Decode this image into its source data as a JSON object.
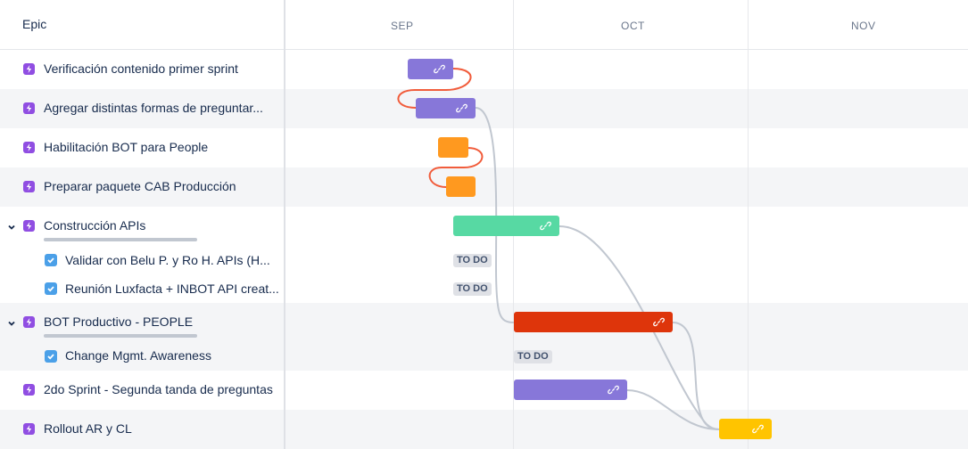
{
  "header": {
    "epic_label": "Epic",
    "months": [
      "SEP",
      "OCT",
      "NOV"
    ]
  },
  "rows": [
    {
      "label": "Verificación contenido primer sprint",
      "type": "epic"
    },
    {
      "label": "Agregar distintas formas de preguntar...",
      "type": "epic"
    },
    {
      "label": "Habilitación BOT para People",
      "type": "epic"
    },
    {
      "label": "Preparar paquete CAB Producción",
      "type": "epic"
    },
    {
      "label": "Construcción APIs",
      "type": "epic",
      "expanded": true
    },
    {
      "label": "Validar con Belu P. y Ro H. APIs (H...",
      "type": "task",
      "status": "TO DO"
    },
    {
      "label": "Reunión Luxfacta + INBOT API creat...",
      "type": "task",
      "status": "TO DO"
    },
    {
      "label": "BOT Productivo - PEOPLE",
      "type": "epic",
      "expanded": true
    },
    {
      "label": "Change Mgmt. Awareness",
      "type": "task",
      "status": "TO DO"
    },
    {
      "label": "2do Sprint - Segunda tanda de preguntas",
      "type": "epic"
    },
    {
      "label": "Rollout AR y CL",
      "type": "epic"
    }
  ],
  "colors": {
    "purple": "#8777d9",
    "orange": "#ff991f",
    "green": "#57d9a3",
    "red": "#de350b",
    "yellow": "#ffc400",
    "epic_icon": "#904ee2",
    "task_icon": "#4ba0e8",
    "link_red": "#f15c3b",
    "link_gray": "#c1c7d0"
  },
  "icons": {
    "epic": "lightning-icon",
    "task": "checkbox-icon",
    "bar_link": "link-icon",
    "expand": "chevron-down-icon"
  }
}
